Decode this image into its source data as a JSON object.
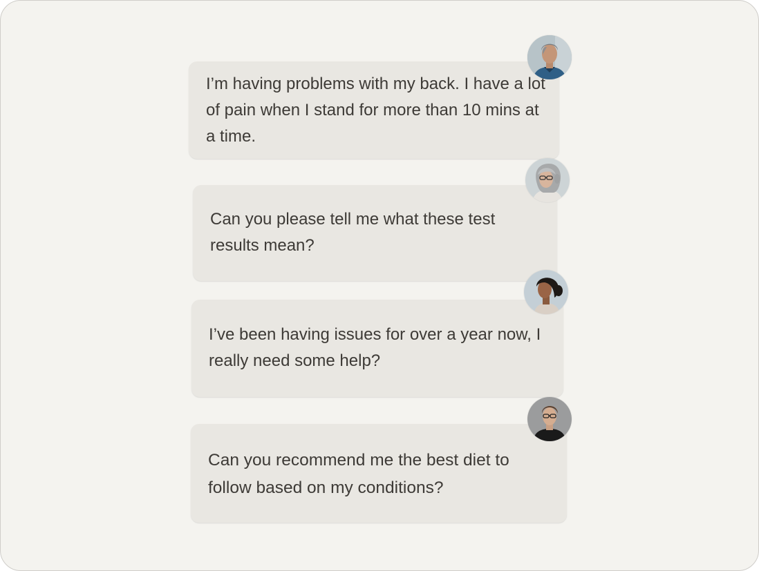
{
  "messages": [
    {
      "text": "I’m having problems with my back. I have a lot of pain when I stand for more than 10 mins at a time.",
      "avatar": "older-man-portrait"
    },
    {
      "text": "Can you please tell me what these test results mean?",
      "avatar": "older-woman-glasses-portrait"
    },
    {
      "text": "I’ve been having issues for over a year now, I really need some help?",
      "avatar": "woman-portrait"
    },
    {
      "text": "Can you recommend me the best diet to follow based on my conditions?",
      "avatar": "young-man-glasses-portrait"
    }
  ],
  "colors": {
    "background": "#f4f3ef",
    "bubble": "#e9e7e2",
    "text": "#3d3a36"
  }
}
